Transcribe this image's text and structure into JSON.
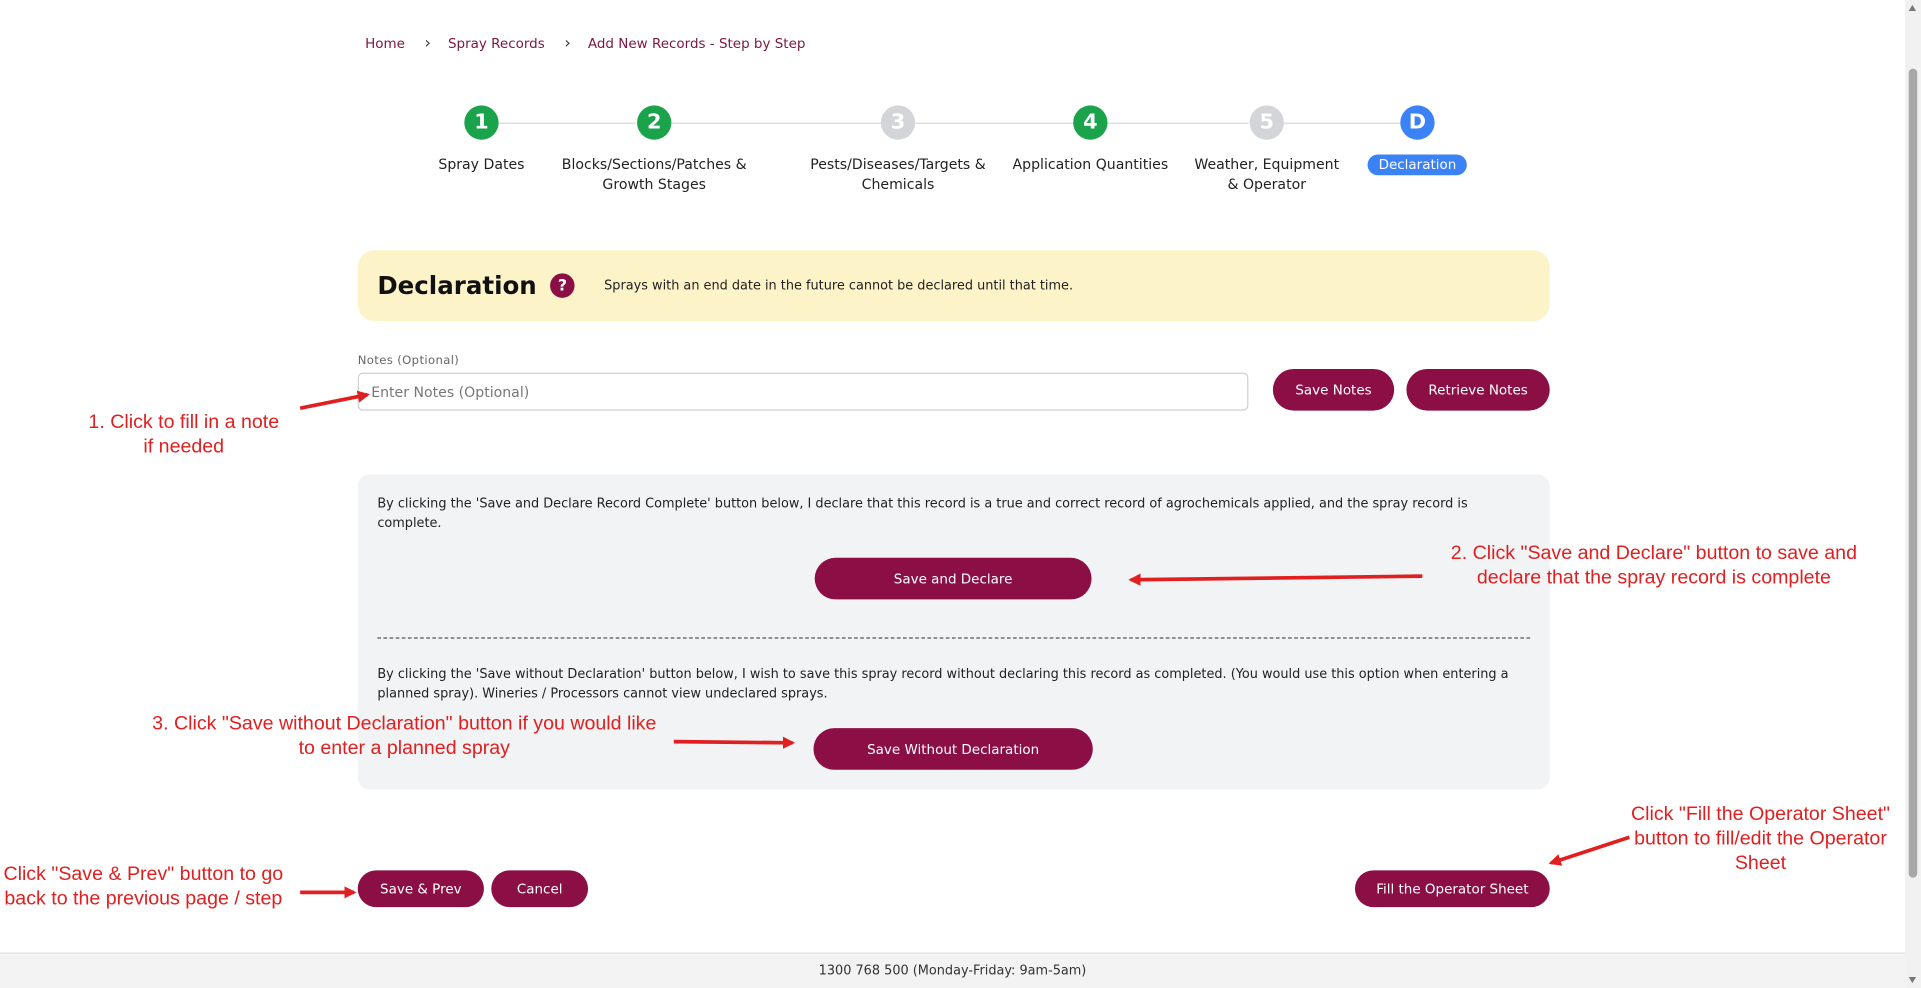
{
  "breadcrumb": {
    "items": [
      "Home",
      "Spray Records",
      "Add New Records - Step by Step"
    ]
  },
  "stepper": {
    "steps": [
      {
        "marker": "1",
        "label": "Spray Dates",
        "state": "done"
      },
      {
        "marker": "2",
        "label": "Blocks/Sections/Patches & Growth Stages",
        "state": "done"
      },
      {
        "marker": "3",
        "label": "Pests/Diseases/Targets & Chemicals",
        "state": "todo"
      },
      {
        "marker": "4",
        "label": "Application Quantities",
        "state": "done"
      },
      {
        "marker": "5",
        "label": "Weather, Equipment & Operator",
        "state": "todo"
      },
      {
        "marker": "D",
        "label": "Declaration",
        "state": "current"
      }
    ]
  },
  "banner": {
    "title": "Declaration",
    "help_symbol": "?",
    "note": "Sprays with an end date in the future cannot be declared until that time."
  },
  "notes": {
    "label": "Notes (Optional)",
    "placeholder": "Enter Notes (Optional)",
    "value": "",
    "save_label": "Save Notes",
    "retrieve_label": "Retrieve Notes"
  },
  "declare": {
    "text": "By clicking the 'Save and Declare Record Complete' button below, I declare that this record is a true and correct record of agrochemicals applied, and the spray record is complete.",
    "button_label": "Save and Declare"
  },
  "no_declare": {
    "text": "By clicking the 'Save without Declaration' button below, I wish to save this spray record without declaring this record as completed. (You would use this option when entering a planned spray). Wineries / Processors cannot view undeclared sprays.",
    "button_label": "Save Without Declaration"
  },
  "actions": {
    "save_prev_label": "Save & Prev",
    "cancel_label": "Cancel",
    "operator_sheet_label": "Fill the Operator Sheet"
  },
  "footer": {
    "contact": "1300 768 500 (Monday-Friday: 9am-5am)"
  },
  "annotations": {
    "note": "1. Click to fill in a note if needed",
    "declare": "2. Click \"Save and Declare\" button to save and declare that the spray record is complete",
    "no_declare": "3. Click \"Save without Declaration\" button if you would like to enter a planned spray",
    "prev": "Click \"Save & Prev\" button to go back to the previous page / step",
    "operator": "Click \"Fill the Operator Sheet\" button to fill/edit the Operator Sheet"
  },
  "colors": {
    "brand": "#8b0f45",
    "step_done": "#1aa34a",
    "step_todo": "#d3d5d9",
    "step_current": "#3b82f6",
    "banner_bg": "#fdf3c9",
    "annotation": "#e02020"
  }
}
